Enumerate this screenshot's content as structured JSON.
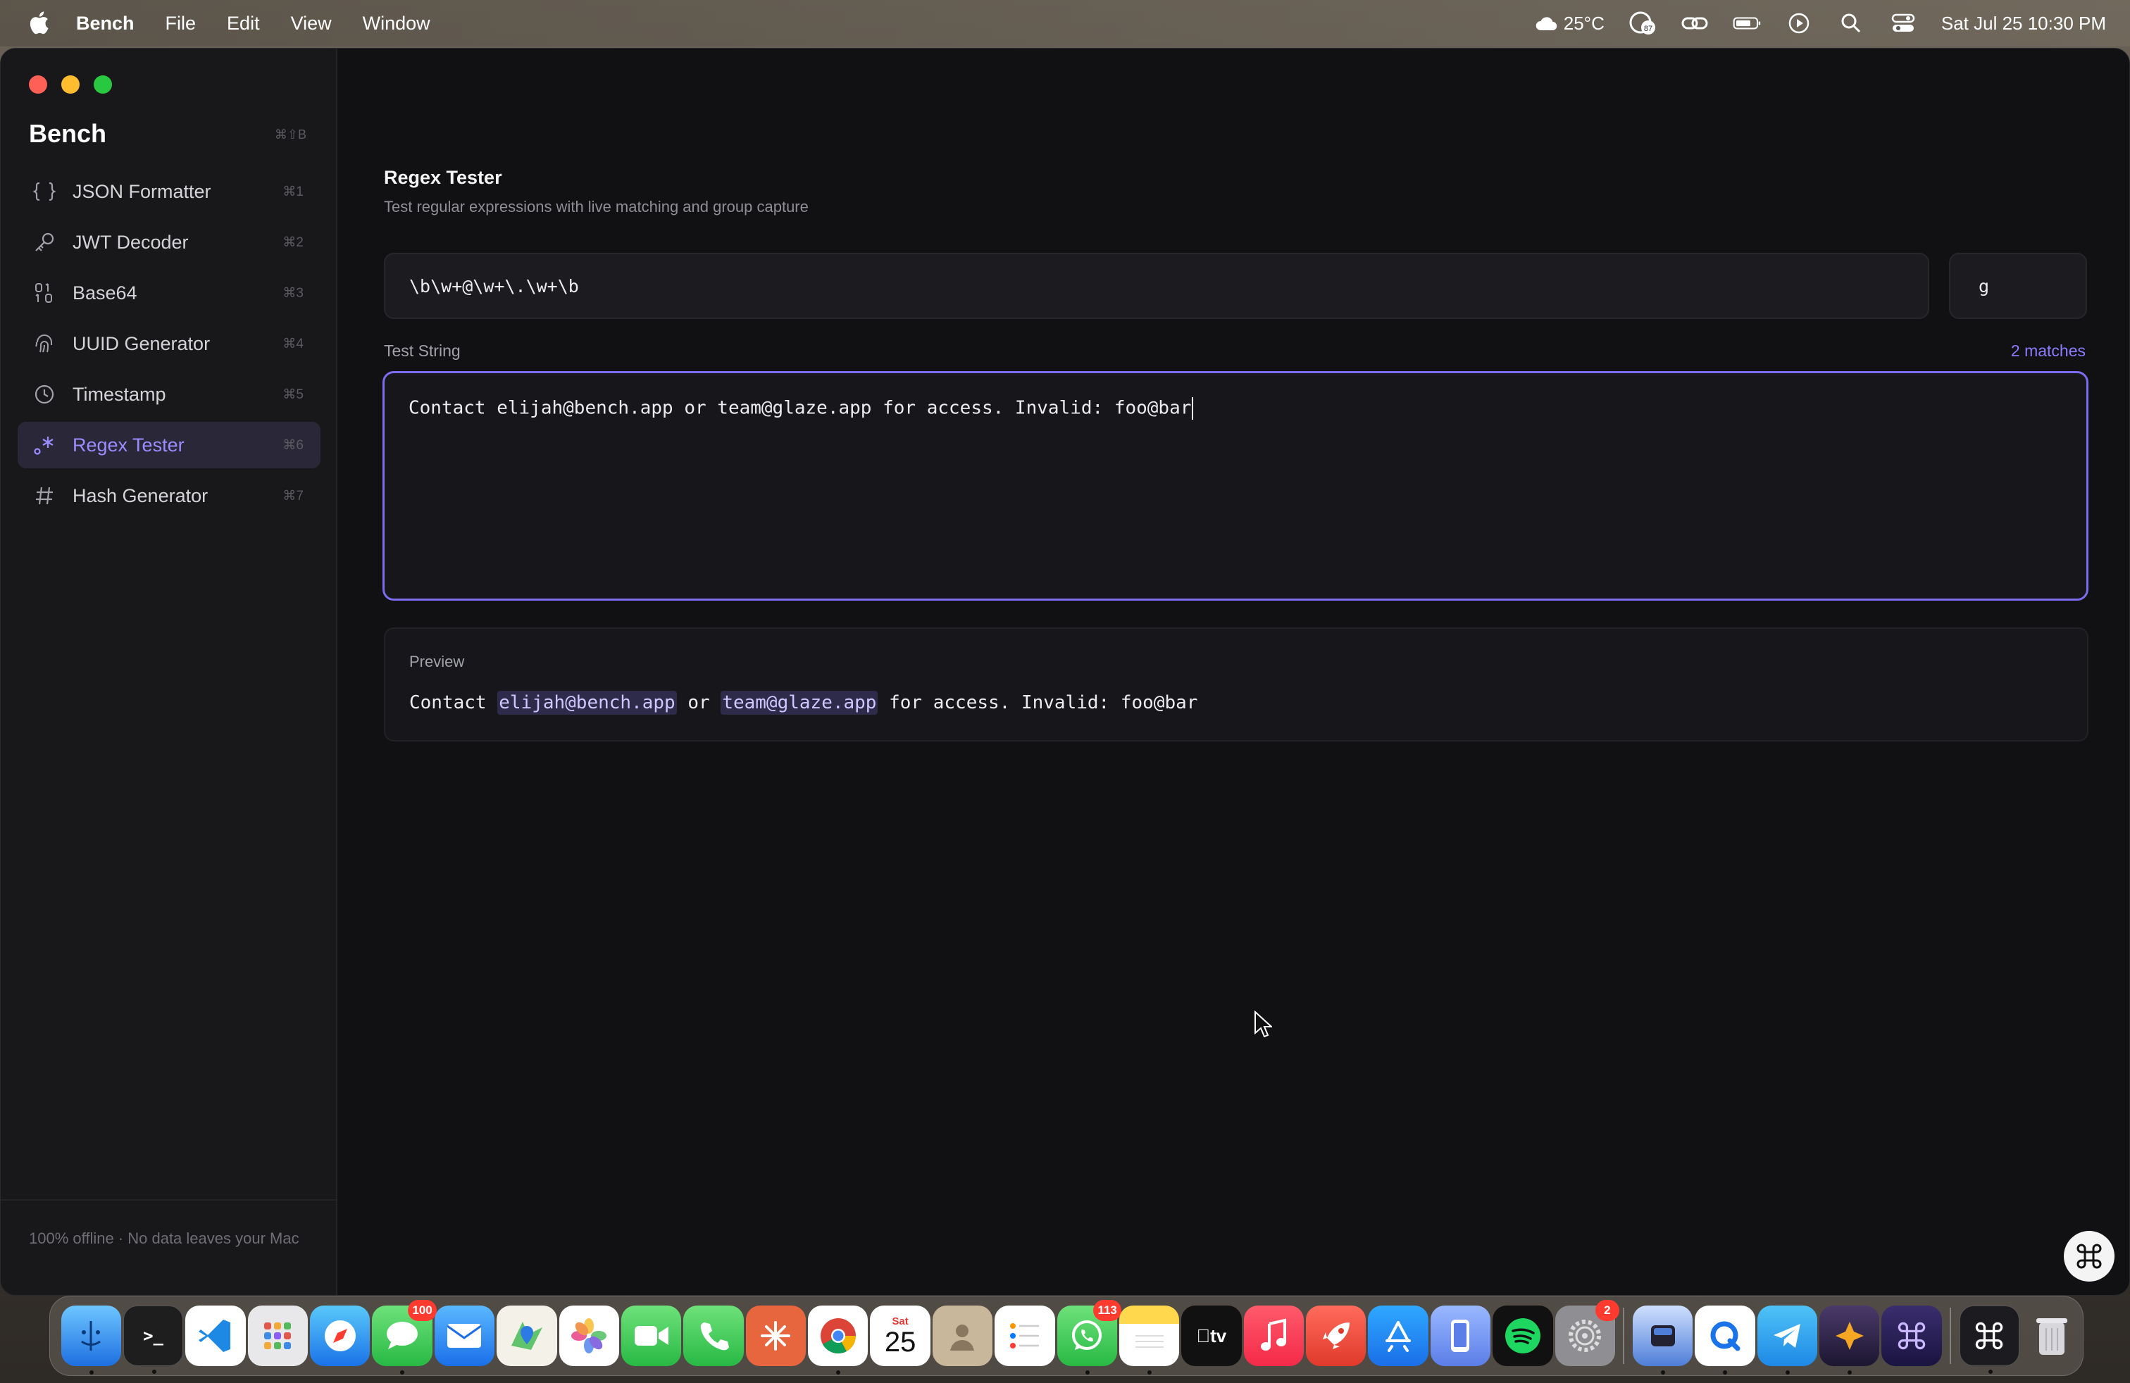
{
  "menubar": {
    "app_name": "Bench",
    "menus": [
      "File",
      "Edit",
      "View",
      "Window"
    ],
    "weather": "25°C",
    "clock": "Sat Jul 25  10:30 PM",
    "notif_count": "87"
  },
  "sidebar": {
    "brand": "Bench",
    "brand_shortcut": "⌘⇧B",
    "items": [
      {
        "label": "JSON Formatter",
        "shortcut": "⌘1",
        "icon": "braces-icon"
      },
      {
        "label": "JWT Decoder",
        "shortcut": "⌘2",
        "icon": "key-icon"
      },
      {
        "label": "Base64",
        "shortcut": "⌘3",
        "icon": "binary-icon"
      },
      {
        "label": "UUID Generator",
        "shortcut": "⌘4",
        "icon": "fingerprint-icon"
      },
      {
        "label": "Timestamp",
        "shortcut": "⌘5",
        "icon": "clock-icon"
      },
      {
        "label": "Regex Tester",
        "shortcut": "⌘6",
        "icon": "regex-icon",
        "active": true
      },
      {
        "label": "Hash Generator",
        "shortcut": "⌘7",
        "icon": "hash-icon"
      }
    ],
    "footer": "100% offline · No data leaves your Mac"
  },
  "main": {
    "title": "Regex Tester",
    "subtitle": "Test regular expressions with live matching and group capture",
    "pattern": "\\b\\w+@\\w+\\.\\w+\\b",
    "flags": "g",
    "test_label": "Test String",
    "match_count": "2 matches",
    "test_string": "Contact elijah@bench.app or team@glaze.app for access. Invalid: foo@bar",
    "preview_label": "Preview",
    "preview": {
      "t1": "Contact ",
      "m1": "elijah@bench.app",
      "t2": " or ",
      "m2": "team@glaze.app",
      "t3": " for access. Invalid: foo@bar"
    }
  },
  "dock": {
    "badges": {
      "messages": "100",
      "whatsapp": "113",
      "settings": "2"
    },
    "calendar": {
      "day": "Sat",
      "date": "25"
    },
    "tv_label": "tv"
  },
  "colors": {
    "accent": "#8b7cff",
    "window_bg": "#111113",
    "sidebar_bg": "#18181b"
  }
}
